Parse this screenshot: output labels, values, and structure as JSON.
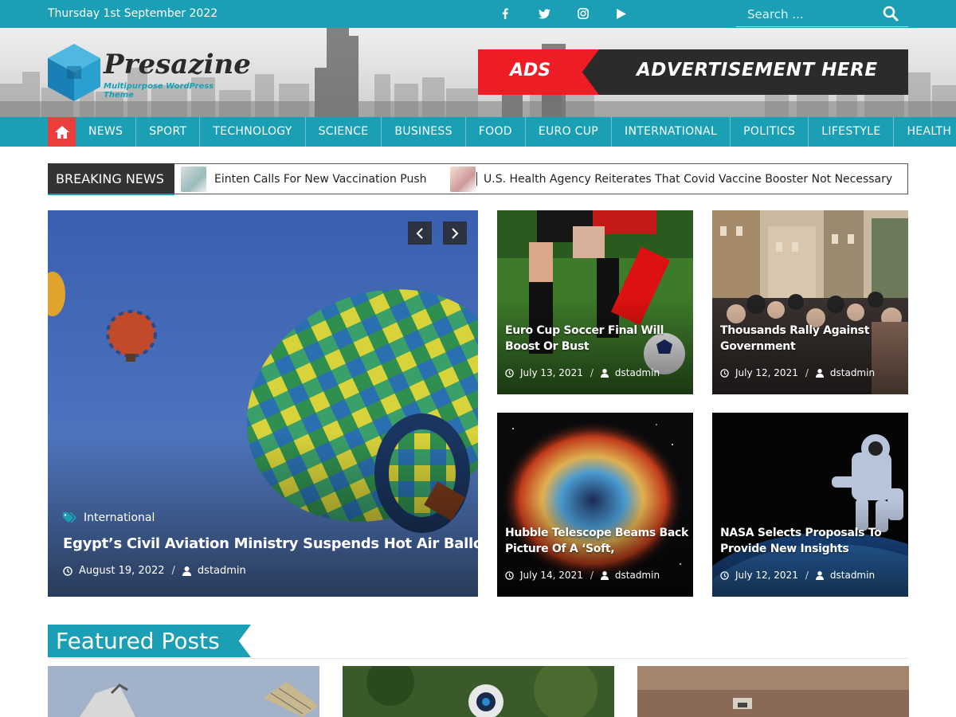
{
  "topbar": {
    "date": "Thursday 1st September 2022",
    "social": [
      "facebook-icon",
      "twitter-icon",
      "instagram-icon",
      "youtube-icon"
    ],
    "search_placeholder": "Search ..."
  },
  "header": {
    "logo_title": "Presazine",
    "logo_subtitle": "Multipurpose WordPress Theme",
    "ad_label": "ADS",
    "ad_text": "ADVERTISEMENT HERE"
  },
  "nav": {
    "items": [
      "NEWS",
      "SPORT",
      "TECHNOLOGY",
      "SCIENCE",
      "BUSINESS",
      "FOOD",
      "EURO CUP",
      "INTERNATIONAL",
      "POLITICS",
      "LIFESTYLE",
      "HEALTH"
    ]
  },
  "breaking": {
    "label": "BREAKING NEWS",
    "items": [
      "Einten Calls For New Vaccination Push",
      "U.S. Health Agency Reiterates That Covid Vaccine Booster Not Necessary"
    ]
  },
  "hero": {
    "category": "International",
    "title": "Egypt’s Civil Aviation Ministry Suspends Hot Air Balloons.",
    "date": "August 19, 2022",
    "author": "dstadmin"
  },
  "cards": [
    {
      "title": "Euro Cup Soccer Final Will Boost Or Bust",
      "date": "July 13, 2021",
      "author": "dstadmin"
    },
    {
      "title": "Thousands Rally Against Government",
      "date": "July 12, 2021",
      "author": "dstadmin"
    },
    {
      "title": "Hubble Telescope Beams Back Picture Of A ‘Soft,",
      "date": "July 14, 2021",
      "author": "dstadmin"
    },
    {
      "title": "NASA Selects Proposals To Provide New Insights",
      "date": "July 12, 2021",
      "author": "dstadmin"
    }
  ],
  "featured": {
    "title": "Featured Posts"
  },
  "colors": {
    "accent": "#1a9fb5",
    "home": "#ee3d3d",
    "ad_red": "#ee1c25",
    "dark": "#333333"
  }
}
